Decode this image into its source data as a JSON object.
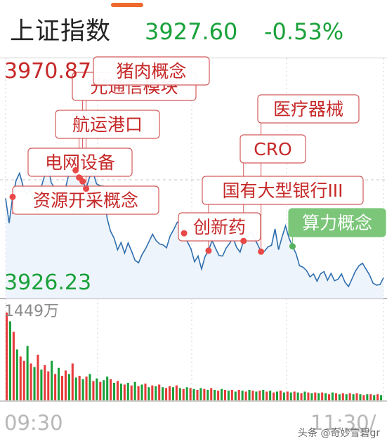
{
  "header": {
    "index_name": "上证指数",
    "price": "3927.60",
    "change": "-0.53%"
  },
  "axis": {
    "high_label": "3970.87",
    "low_label": "3926.23",
    "volume_label": "1449万",
    "time_start": "09:30",
    "time_end": "11:30/"
  },
  "watermark": "头条 @奇妙雪碧gr",
  "colors": {
    "up": "#e83a3a",
    "down": "#19a13a",
    "line": "#2f6fae",
    "tag_border": "#d45a5a",
    "tag_green": "#7cc67a"
  },
  "chart_data": {
    "type": "line",
    "y_range": [
      3926.23,
      3970.87
    ],
    "x_range": [
      "09:30",
      "11:30"
    ],
    "price_series": [
      3944.0,
      3938.9,
      3944.3,
      3947.7,
      3949.2,
      3946.5,
      3944.7,
      3946.0,
      3943.6,
      3941.2,
      3945.9,
      3948.3,
      3951.3,
      3947.3,
      3946.1,
      3944.6,
      3944.3,
      3945.8,
      3948.8,
      3950.6,
      3949.8,
      3948.3,
      3947.5,
      3946.0,
      3948.4,
      3949.3,
      3947.0,
      3946.6,
      3946.5,
      3939.9,
      3937.2,
      3935.8,
      3933.4,
      3934.9,
      3932.7,
      3934.8,
      3933.1,
      3931.2,
      3930.7,
      3932.4,
      3933.6,
      3935.1,
      3936.6,
      3935.3,
      3934.6,
      3934.4,
      3933.8,
      3936.2,
      3937.5,
      3939.0,
      3939.5,
      3936.8,
      3935.0,
      3933.5,
      3930.9,
      3932.1,
      3929.4,
      3932.0,
      3933.2,
      3935.3,
      3933.7,
      3932.2,
      3932.1,
      3933.7,
      3934.7,
      3935.9,
      3933.9,
      3932.9,
      3935.2,
      3936.0,
      3937.1,
      3935.9,
      3934.5,
      3933.0,
      3933.1,
      3934.0,
      3934.3,
      3937.7,
      3933.4,
      3936.0,
      3938.3,
      3935.8,
      3934.1,
      3932.6,
      3930.1,
      3929.8,
      3929.1,
      3927.8,
      3928.4,
      3926.9,
      3928.4,
      3928.9,
      3927.1,
      3928.5,
      3927.0,
      3927.3,
      3928.4,
      3926.7,
      3925.8,
      3927.4,
      3929.0,
      3930.1,
      3930.6,
      3929.4,
      3928.2,
      3926.5,
      3926.1,
      3926.2,
      3927.6
    ],
    "volume_max": "1449万",
    "volume_series": [
      {
        "v": 100,
        "dir": "up"
      },
      {
        "v": 90,
        "dir": "down"
      },
      {
        "v": 78,
        "dir": "up"
      },
      {
        "v": 58,
        "dir": "down"
      },
      {
        "v": 50,
        "dir": "up"
      },
      {
        "v": 45,
        "dir": "up"
      },
      {
        "v": 62,
        "dir": "down"
      },
      {
        "v": 42,
        "dir": "up"
      },
      {
        "v": 38,
        "dir": "down"
      },
      {
        "v": 52,
        "dir": "up"
      },
      {
        "v": 35,
        "dir": "down"
      },
      {
        "v": 40,
        "dir": "up"
      },
      {
        "v": 33,
        "dir": "up"
      },
      {
        "v": 45,
        "dir": "down"
      },
      {
        "v": 30,
        "dir": "up"
      },
      {
        "v": 37,
        "dir": "down"
      },
      {
        "v": 28,
        "dir": "up"
      },
      {
        "v": 34,
        "dir": "up"
      },
      {
        "v": 30,
        "dir": "down"
      },
      {
        "v": 42,
        "dir": "up"
      },
      {
        "v": 26,
        "dir": "down"
      },
      {
        "v": 28,
        "dir": "up"
      },
      {
        "v": 24,
        "dir": "down"
      },
      {
        "v": 27,
        "dir": "up"
      },
      {
        "v": 30,
        "dir": "down"
      },
      {
        "v": 22,
        "dir": "up"
      },
      {
        "v": 25,
        "dir": "down"
      },
      {
        "v": 21,
        "dir": "up"
      },
      {
        "v": 23,
        "dir": "down"
      },
      {
        "v": 27,
        "dir": "down"
      },
      {
        "v": 24,
        "dir": "up"
      },
      {
        "v": 20,
        "dir": "down"
      },
      {
        "v": 22,
        "dir": "up"
      },
      {
        "v": 19,
        "dir": "down"
      },
      {
        "v": 18,
        "dir": "up"
      },
      {
        "v": 20,
        "dir": "down"
      },
      {
        "v": 17,
        "dir": "up"
      },
      {
        "v": 21,
        "dir": "down"
      },
      {
        "v": 16,
        "dir": "up"
      },
      {
        "v": 18,
        "dir": "down"
      },
      {
        "v": 19,
        "dir": "up"
      },
      {
        "v": 15,
        "dir": "down"
      },
      {
        "v": 17,
        "dir": "up"
      },
      {
        "v": 16,
        "dir": "down"
      },
      {
        "v": 18,
        "dir": "up"
      },
      {
        "v": 15,
        "dir": "down"
      },
      {
        "v": 14,
        "dir": "up"
      },
      {
        "v": 16,
        "dir": "up"
      },
      {
        "v": 15,
        "dir": "down"
      },
      {
        "v": 17,
        "dir": "up"
      },
      {
        "v": 14,
        "dir": "down"
      },
      {
        "v": 13,
        "dir": "up"
      },
      {
        "v": 15,
        "dir": "down"
      },
      {
        "v": 14,
        "dir": "up"
      },
      {
        "v": 13,
        "dir": "down"
      },
      {
        "v": 12,
        "dir": "up"
      },
      {
        "v": 14,
        "dir": "down"
      },
      {
        "v": 13,
        "dir": "up"
      },
      {
        "v": 12,
        "dir": "down"
      },
      {
        "v": 14,
        "dir": "up"
      },
      {
        "v": 12,
        "dir": "down"
      },
      {
        "v": 11,
        "dir": "up"
      },
      {
        "v": 13,
        "dir": "down"
      },
      {
        "v": 12,
        "dir": "up"
      },
      {
        "v": 11,
        "dir": "down"
      },
      {
        "v": 12,
        "dir": "up"
      },
      {
        "v": 10,
        "dir": "down"
      },
      {
        "v": 12,
        "dir": "up"
      },
      {
        "v": 11,
        "dir": "down"
      },
      {
        "v": 10,
        "dir": "up"
      },
      {
        "v": 12,
        "dir": "down"
      },
      {
        "v": 11,
        "dir": "up"
      },
      {
        "v": 10,
        "dir": "down"
      },
      {
        "v": 11,
        "dir": "up"
      },
      {
        "v": 12,
        "dir": "down"
      },
      {
        "v": 10,
        "dir": "up"
      },
      {
        "v": 11,
        "dir": "down"
      },
      {
        "v": 9,
        "dir": "up"
      },
      {
        "v": 10,
        "dir": "down"
      },
      {
        "v": 11,
        "dir": "up"
      },
      {
        "v": 9,
        "dir": "down"
      },
      {
        "v": 10,
        "dir": "up"
      },
      {
        "v": 9,
        "dir": "down"
      },
      {
        "v": 10,
        "dir": "up"
      },
      {
        "v": 9,
        "dir": "down"
      },
      {
        "v": 8,
        "dir": "up"
      },
      {
        "v": 10,
        "dir": "down"
      },
      {
        "v": 9,
        "dir": "up"
      },
      {
        "v": 8,
        "dir": "down"
      },
      {
        "v": 9,
        "dir": "up"
      },
      {
        "v": 8,
        "dir": "down"
      },
      {
        "v": 9,
        "dir": "up"
      },
      {
        "v": 8,
        "dir": "down"
      },
      {
        "v": 7,
        "dir": "up"
      },
      {
        "v": 9,
        "dir": "down"
      },
      {
        "v": 8,
        "dir": "up"
      },
      {
        "v": 7,
        "dir": "down"
      },
      {
        "v": 8,
        "dir": "up"
      },
      {
        "v": 7,
        "dir": "down"
      },
      {
        "v": 8,
        "dir": "up"
      },
      {
        "v": 7,
        "dir": "down"
      },
      {
        "v": 8,
        "dir": "up"
      },
      {
        "v": 7,
        "dir": "down"
      },
      {
        "v": 6,
        "dir": "up"
      },
      {
        "v": 7,
        "dir": "down"
      },
      {
        "v": 7,
        "dir": "up"
      },
      {
        "v": 6,
        "dir": "down"
      },
      {
        "v": 7,
        "dir": "up"
      },
      {
        "v": 6,
        "dir": "down"
      }
    ],
    "events": [
      {
        "label": "资源开采概念",
        "index": 2,
        "style": "red"
      },
      {
        "label": "电网设备",
        "index": 20,
        "style": "red"
      },
      {
        "label": "航运港口",
        "index": 21,
        "style": "red"
      },
      {
        "label": "光通信模块",
        "index": 22,
        "style": "red"
      },
      {
        "label": "猪肉概念",
        "index": 23,
        "style": "red"
      },
      {
        "label": "创新药",
        "index": 51,
        "style": "red"
      },
      {
        "label": "国有大型银行III",
        "index": 58,
        "style": "red"
      },
      {
        "label": "CRO",
        "index": 68,
        "style": "red"
      },
      {
        "label": "医疗器械",
        "index": 73,
        "style": "red"
      },
      {
        "label": "算力概念",
        "index": 82,
        "style": "green"
      }
    ]
  }
}
